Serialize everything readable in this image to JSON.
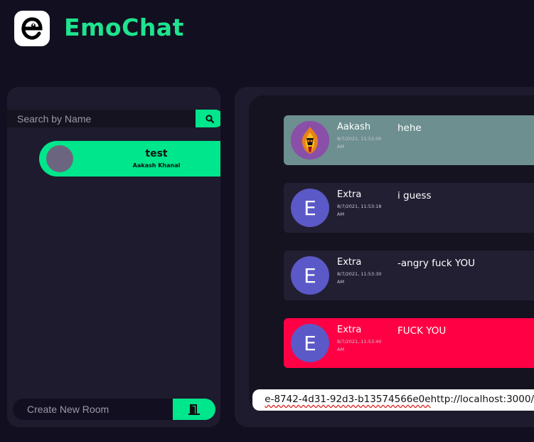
{
  "app": {
    "title": "EmoChat",
    "logo_letter": "e",
    "accent": "#1ee38f"
  },
  "sidebar": {
    "search": {
      "placeholder": "Search by Name",
      "value": ""
    },
    "rooms": [
      {
        "name": "test",
        "owner": "Aakash Khanal"
      }
    ],
    "create": {
      "placeholder": "Create New Room",
      "value": ""
    }
  },
  "chat": {
    "messages": [
      {
        "author": "Aakash",
        "time": "8/7/2021, 11:53:00 AM",
        "text": "hehe",
        "avatar_letter": "",
        "bg": "#6d8f90"
      },
      {
        "author": "Extra",
        "time": "8/7/2021, 11:53:18 AM",
        "text": "i guess",
        "avatar_letter": "E",
        "bg": "#221f33"
      },
      {
        "author": "Extra",
        "time": "8/7/2021, 11:53:30 AM",
        "text": "-angry fuck YOU",
        "avatar_letter": "E",
        "bg": "#221f33"
      },
      {
        "author": "Extra",
        "time": "8/7/2021, 11:53:40 AM",
        "text": "FUCK YOU",
        "avatar_letter": "E",
        "bg": "#ff0044"
      }
    ],
    "link_prefix": "e-8742-4d31-92d3-b13574566e0e",
    "link_suffix": "http://localhost:3000/"
  }
}
